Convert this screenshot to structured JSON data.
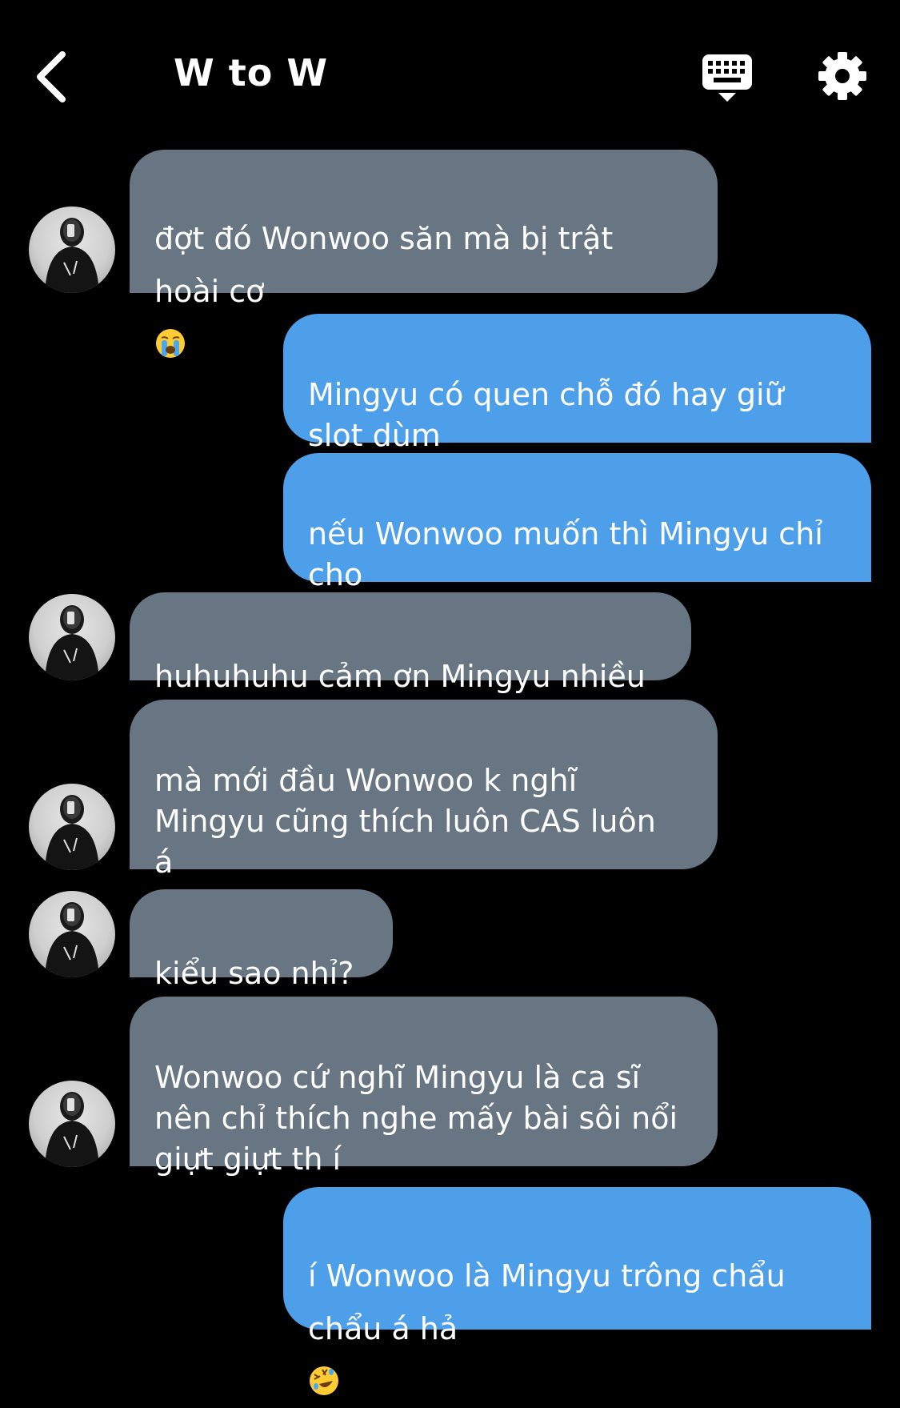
{
  "header": {
    "title": "W to W",
    "back_icon": "chevron-left-icon",
    "keyboard_icon": "keyboard-icon",
    "settings_icon": "gear-icon"
  },
  "colors": {
    "background": "#000000",
    "incoming_bubble": "#687583",
    "outgoing_bubble": "#4e9fe9",
    "text": "#ffffff"
  },
  "messages": [
    {
      "side": "in",
      "text": "đợt đó Wonwoo săn mà bị trật\nhoài cơ",
      "emoji": "loudly-crying-face"
    },
    {
      "side": "out",
      "text": "Mingyu có quen chỗ đó hay giữ\nslot dùm"
    },
    {
      "side": "out",
      "text": "nếu Wonwoo muốn thì Mingyu chỉ\ncho"
    },
    {
      "side": "in",
      "text": "huhuhuhu cảm ơn Mingyu nhiều"
    },
    {
      "side": "in",
      "text": "mà mới đầu Wonwoo k nghĩ\nMingyu cũng thích luôn CAS luôn\ná"
    },
    {
      "side": "in",
      "text": "kiểu sao nhỉ?"
    },
    {
      "side": "in",
      "text": "Wonwoo cứ nghĩ Mingyu là ca sĩ\nnên chỉ thích nghe mấy bài sôi nổi\ngiựt giựt th í"
    },
    {
      "side": "out",
      "text": "í Wonwoo là Mingyu trông chẩu\nchẩu á hả",
      "emoji": "rolling-on-the-floor-laughing"
    }
  ]
}
